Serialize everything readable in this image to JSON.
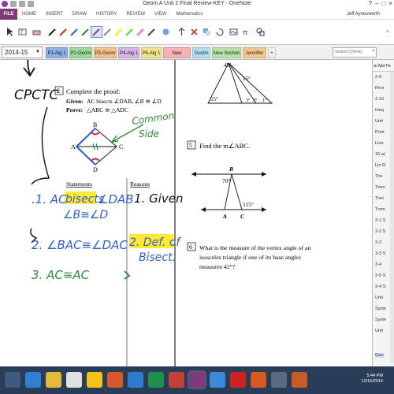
{
  "window": {
    "title": "Geom A Unit 2 Final Review-KEY - OneNote"
  },
  "menu": {
    "items": [
      "FILE",
      "HOME",
      "INSERT",
      "DRAW",
      "HISTORY",
      "REVIEW",
      "VIEW",
      "Mathematics"
    ],
    "user": "Jeff Aynesworth"
  },
  "notebook": {
    "name": "2014-15"
  },
  "section_tabs": [
    {
      "label": "P1-Alg 1",
      "color": "#8fb0e6"
    },
    {
      "label": "P2-Geom",
      "color": "#9fd89f"
    },
    {
      "label": "P3-Geom",
      "color": "#f7c08a"
    },
    {
      "label": "P4-Alg 1",
      "color": "#d7b6e6"
    },
    {
      "label": "P6-Alg 1",
      "color": "#f0e58c"
    },
    {
      "label": "New Section 1",
      "color": "#f4b1b1"
    },
    {
      "label": "Dustin",
      "color": "#aee0f5"
    },
    {
      "label": "New Section 2",
      "color": "#b8e3a8"
    },
    {
      "label": "Jenniffer",
      "color": "#f3ca8e"
    }
  ],
  "search": {
    "placeholder": "Search (Ctrl+E)"
  },
  "page_list": {
    "header": "Add Pa",
    "items": [
      "2-9",
      "Revi",
      "2-10",
      "Ineq",
      "Unit",
      "Print",
      "Line",
      "15 a(",
      "Lin R",
      "The",
      "Trem",
      "Tren",
      "Trem",
      "3-1 S",
      "3-2 S",
      "3-2",
      "3-3 S",
      "3-4",
      "3-5 S",
      "3-4 S",
      "Unit",
      "Syste",
      "Syste",
      "Unit",
      "Geo"
    ]
  },
  "problem2": {
    "number": "2",
    "prompt": "Complete the proof:",
    "given_prefix": "Given:",
    "given": "AC bisects ∠DAB, ∠B ≅ ∠D",
    "prove_prefix": "Prove:",
    "prove": "△ABC ≅ △ADC",
    "vertices": {
      "A": "A",
      "B": "B",
      "C": "C",
      "D": "D"
    },
    "col_statements": "Statements",
    "col_reasons": "Reasons"
  },
  "problem5": {
    "number": "5",
    "text": "Find the m∠ABC.",
    "label_B": "B",
    "label_A": "A",
    "label_C": "C",
    "angle1": "70°",
    "angle2": "115°"
  },
  "problem6": {
    "number": "6",
    "text_lines": [
      "What is the measure of the vertex angle of an",
      "isosceles triangle if one of its base angles",
      "measures 42°?"
    ]
  },
  "top_figure": {
    "labels": [
      "45°",
      "15°",
      "55°",
      "3°",
      "2°",
      "1°"
    ]
  },
  "ink": {
    "cpctc": "CPCTC",
    "note_line1": "Common",
    "note_line2": "Side",
    "stmt1_prefix": ".1. AC",
    "stmt1_highlight": "bisects",
    "stmt1_suffix": "∠DAB",
    "stmt1_line2": "∠B≅∠D",
    "stmt2": "2. ∠BAC≅∠DAC",
    "stmt3": "3. AC≅AC",
    "reason1": "1. Given",
    "reason2_line1": "2. Def. of",
    "reason2_line2": "Bisect."
  },
  "taskbar": {
    "time": "5:44 PM",
    "date": "12/15/2014"
  },
  "colors": {
    "file_tab": "#80397b",
    "taskbar": "#2a3d56",
    "ink_blue": "#2f5fc8",
    "ink_green": "#2e8b3a",
    "highlight": "#ffe933",
    "ink_red": "#d9232d"
  }
}
